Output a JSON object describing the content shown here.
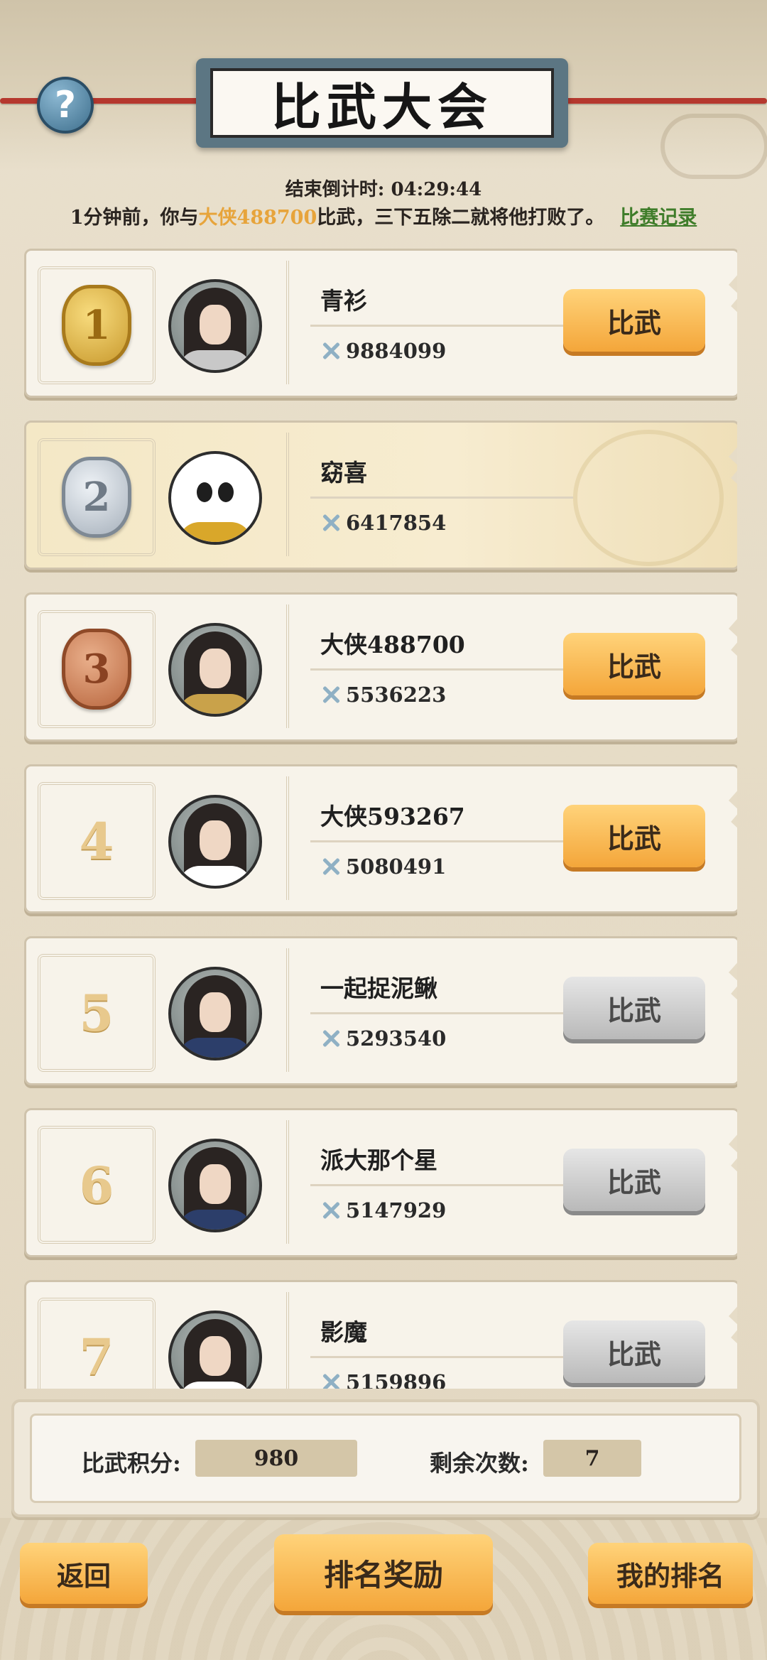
{
  "header": {
    "title": "比武大会",
    "help_icon": "?",
    "countdown": "结束倒计时: 04:29:44",
    "news_prefix": "1分钟前，你与",
    "news_opponent": "大侠488700",
    "news_suffix": "比武，三下五除二就将他打败了。",
    "news_link": "比赛记录"
  },
  "rankings": [
    {
      "rank": "1",
      "medal": "gold",
      "name": "青衫",
      "power": "9884099",
      "button": "比武",
      "button_state": "on"
    },
    {
      "rank": "2",
      "medal": "silver",
      "name": "窈喜",
      "power": "6417854",
      "button": "",
      "button_state": "hidden"
    },
    {
      "rank": "3",
      "medal": "bronze",
      "name": "大侠488700",
      "power": "5536223",
      "button": "比武",
      "button_state": "on"
    },
    {
      "rank": "4",
      "medal": "",
      "name": "大侠593267",
      "power": "5080491",
      "button": "比武",
      "button_state": "on"
    },
    {
      "rank": "5",
      "medal": "",
      "name": "一起捉泥鳅",
      "power": "5293540",
      "button": "比武",
      "button_state": "off"
    },
    {
      "rank": "6",
      "medal": "",
      "name": "派大那个星",
      "power": "5147929",
      "button": "比武",
      "button_state": "off"
    },
    {
      "rank": "7",
      "medal": "",
      "name": "影魔",
      "power": "5159896",
      "button": "比武",
      "button_state": "off"
    }
  ],
  "stats": {
    "score_label": "比武积分:",
    "score_value": "980",
    "remaining_label": "剩余次数:",
    "remaining_value": "7"
  },
  "footer": {
    "back": "返回",
    "rewards": "排名奖励",
    "my_rank": "我的排名"
  },
  "colors": {
    "highlight_name": "#e7a43b",
    "link_green": "#3f7d2a",
    "button_orange": "#f4a63a",
    "button_disabled": "#b9b9b9"
  }
}
